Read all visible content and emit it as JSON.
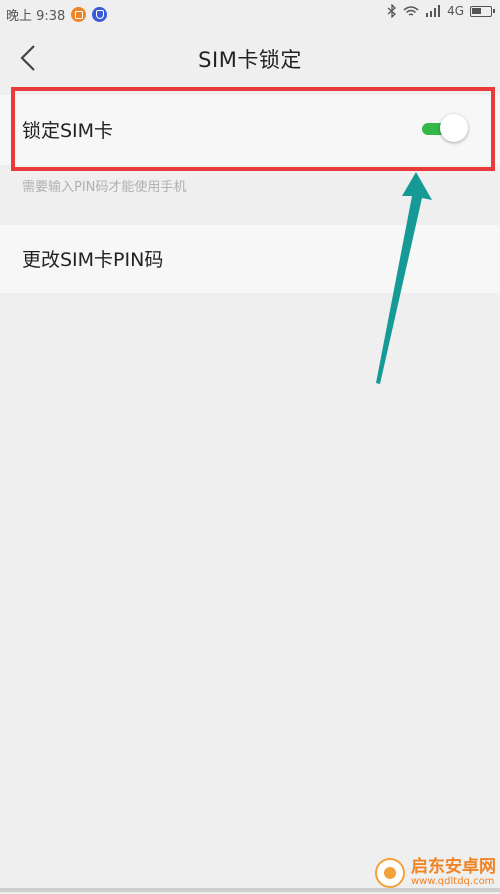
{
  "status_bar": {
    "time": "晚上 9:38",
    "network": "4G",
    "icons": [
      "notification-orange-icon",
      "shield-blue-icon",
      "bluetooth-icon",
      "wifi-icon",
      "signal-icon",
      "battery-charging-icon"
    ]
  },
  "header": {
    "title": "SIM卡锁定",
    "back_icon": "chevron-left-icon"
  },
  "settings": {
    "lock_sim": {
      "label": "锁定SIM卡",
      "enabled": true,
      "hint": "需要输入PIN码才能使用手机"
    },
    "change_pin": {
      "label": "更改SIM卡PIN码"
    }
  },
  "annotation": {
    "highlight_color": "#e93b3b",
    "arrow_color": "#159a96"
  },
  "colors": {
    "toggle_on": "#35b84a",
    "background": "#efefef"
  },
  "watermark": {
    "title": "启东安卓网",
    "url": "www.qdltdq.com"
  }
}
